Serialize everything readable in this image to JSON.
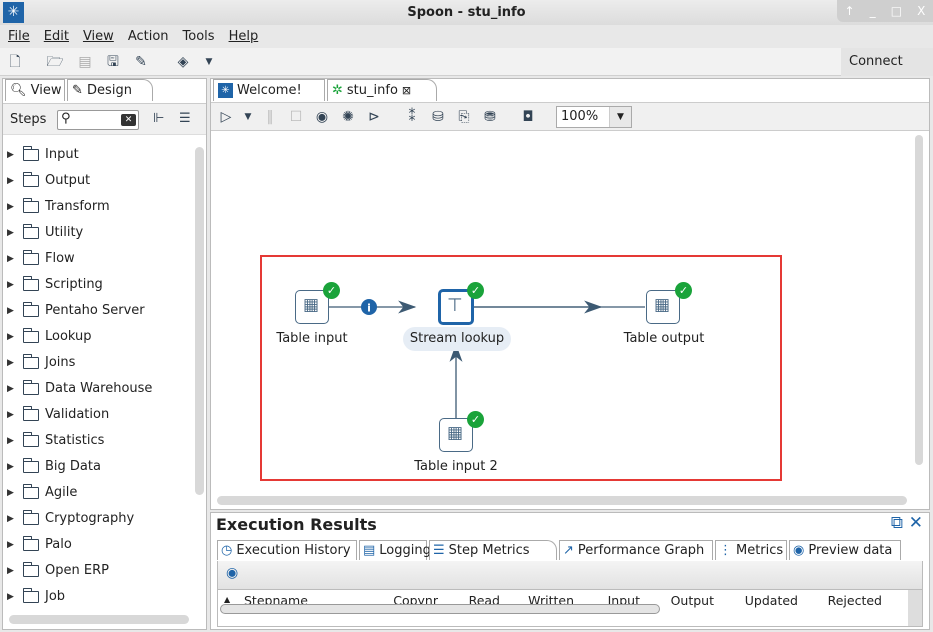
{
  "window": {
    "title": "Spoon - stu_info",
    "controls": [
      "↑",
      "_",
      "□",
      "X"
    ]
  },
  "menu": [
    "File",
    "Edit",
    "View",
    "Action",
    "Tools",
    "Help"
  ],
  "toolbar": {
    "connect": "Connect"
  },
  "left_panel": {
    "tabs": [
      "View",
      "Design"
    ],
    "steps_label": "Steps",
    "search_value": "",
    "categories": [
      "Input",
      "Output",
      "Transform",
      "Utility",
      "Flow",
      "Scripting",
      "Pentaho Server",
      "Lookup",
      "Joins",
      "Data Warehouse",
      "Validation",
      "Statistics",
      "Big Data",
      "Agile",
      "Cryptography",
      "Palo",
      "Open ERP",
      "Job"
    ]
  },
  "editor": {
    "tabs": [
      "Welcome!",
      "stu_info"
    ],
    "zoom": "100%"
  },
  "canvas": {
    "highlight_color": "#e53935",
    "nodes": [
      {
        "label": "Table input",
        "status": "ok"
      },
      {
        "label": "Stream lookup",
        "status": "ok",
        "selected": true
      },
      {
        "label": "Table output",
        "status": "ok"
      },
      {
        "label": "Table input 2",
        "status": "ok"
      }
    ]
  },
  "execution": {
    "title": "Execution Results",
    "tabs": [
      "Execution History",
      "Logging",
      "Step Metrics",
      "Performance Graph",
      "Metrics",
      "Preview data"
    ],
    "active_tab": "Step Metrics",
    "columns": [
      "Stepname",
      "Copynr",
      "Read",
      "Written",
      "Input",
      "Output",
      "Updated",
      "Rejected"
    ]
  }
}
